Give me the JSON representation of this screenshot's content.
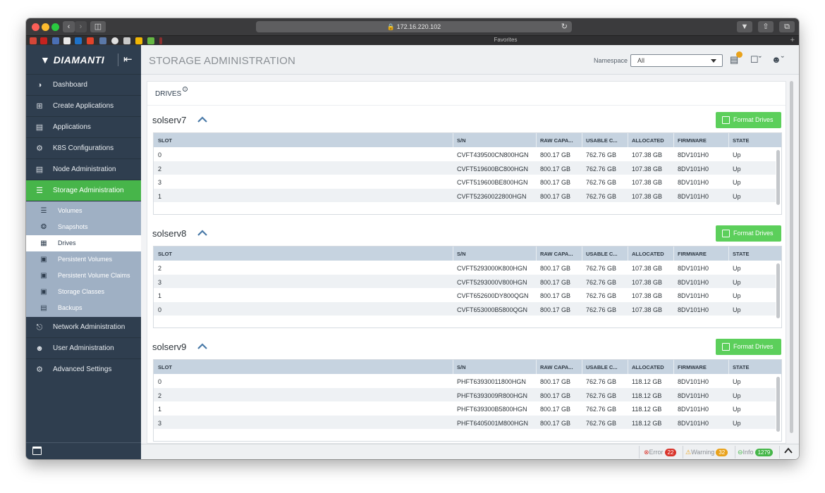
{
  "browser": {
    "url": "172.16.220.102",
    "favorites_title": "Favorites"
  },
  "brand": {
    "name": "DIAMANTI"
  },
  "sidebar": {
    "items": [
      {
        "label": "Dashboard",
        "icon": "speedometer-icon"
      },
      {
        "label": "Create Applications",
        "icon": "plus-square-icon"
      },
      {
        "label": "Applications",
        "icon": "list-icon"
      },
      {
        "label": "K8S Configurations",
        "icon": "gear-icon"
      },
      {
        "label": "Node Administration",
        "icon": "server-icon"
      },
      {
        "label": "Storage Administration",
        "icon": "database-icon",
        "active": true
      }
    ],
    "sub_items": [
      {
        "label": "Volumes",
        "icon": "database-icon"
      },
      {
        "label": "Snapshots",
        "icon": "camera-icon"
      },
      {
        "label": "Drives",
        "icon": "drive-icon",
        "active": true
      },
      {
        "label": "Persistent Volumes",
        "icon": "volume-icon"
      },
      {
        "label": "Persistent Volume Claims",
        "icon": "claim-icon"
      },
      {
        "label": "Storage Classes",
        "icon": "storage-class-icon"
      },
      {
        "label": "Backups",
        "icon": "backup-icon"
      }
    ],
    "bottom_items": [
      {
        "label": "Network Administration",
        "icon": "network-icon"
      },
      {
        "label": "User Administration",
        "icon": "users-icon"
      },
      {
        "label": "Advanced Settings",
        "icon": "settings-icon"
      }
    ]
  },
  "header": {
    "title": "STORAGE ADMINISTRATION",
    "namespace_label": "Namespace",
    "namespace_value": "All"
  },
  "content": {
    "section_title": "DRIVES",
    "format_button_label": "Format Drives",
    "columns": [
      "SLOT",
      "S/N",
      "RAW CAPA...",
      "USABLE C...",
      "ALLOCATED",
      "FIRMWARE",
      "STATE"
    ],
    "servers": [
      {
        "name": "solserv7",
        "rows": [
          [
            "0",
            "CVFT439500CN800HGN",
            "800.17 GB",
            "762.76 GB",
            "107.38 GB",
            "8DV101H0",
            "Up"
          ],
          [
            "2",
            "CVFT519600BC800HGN",
            "800.17 GB",
            "762.76 GB",
            "107.38 GB",
            "8DV101H0",
            "Up"
          ],
          [
            "3",
            "CVFT519600BE800HGN",
            "800.17 GB",
            "762.76 GB",
            "107.38 GB",
            "8DV101H0",
            "Up"
          ],
          [
            "1",
            "CVFT52360022800HGN",
            "800.17 GB",
            "762.76 GB",
            "107.38 GB",
            "8DV101H0",
            "Up"
          ]
        ]
      },
      {
        "name": "solserv8",
        "rows": [
          [
            "2",
            "CVFT5293000K800HGN",
            "800.17 GB",
            "762.76 GB",
            "107.38 GB",
            "8DV101H0",
            "Up"
          ],
          [
            "3",
            "CVFT5293000V800HGN",
            "800.17 GB",
            "762.76 GB",
            "107.38 GB",
            "8DV101H0",
            "Up"
          ],
          [
            "1",
            "CVFT652600DY800QGN",
            "800.17 GB",
            "762.76 GB",
            "107.38 GB",
            "8DV101H0",
            "Up"
          ],
          [
            "0",
            "CVFT653000B5800QGN",
            "800.17 GB",
            "762.76 GB",
            "107.38 GB",
            "8DV101H0",
            "Up"
          ]
        ]
      },
      {
        "name": "solserv9",
        "rows": [
          [
            "0",
            "PHFT63930011800HGN",
            "800.17 GB",
            "762.76 GB",
            "118.12 GB",
            "8DV101H0",
            "Up"
          ],
          [
            "2",
            "PHFT6393009R800HGN",
            "800.17 GB",
            "762.76 GB",
            "118.12 GB",
            "8DV101H0",
            "Up"
          ],
          [
            "1",
            "PHFT639300B5800HGN",
            "800.17 GB",
            "762.76 GB",
            "118.12 GB",
            "8DV101H0",
            "Up"
          ],
          [
            "3",
            "PHFT6405001M800HGN",
            "800.17 GB",
            "762.76 GB",
            "118.12 GB",
            "8DV101H0",
            "Up"
          ]
        ]
      }
    ]
  },
  "footer": {
    "error_label": "Error",
    "error_count": "22",
    "warning_label": "Warning",
    "warning_count": "32",
    "info_label": "Info",
    "info_count": "1279"
  },
  "colors": {
    "sidebar_bg": "#2f3e4f",
    "active_green": "#47b54a",
    "button_green": "#5ccf5b",
    "submenu_bg": "#9fb0c4",
    "table_header_bg": "#c6d3e0",
    "error_red": "#d9342b",
    "warning_orange": "#e9a21b",
    "info_green": "#45b649"
  }
}
